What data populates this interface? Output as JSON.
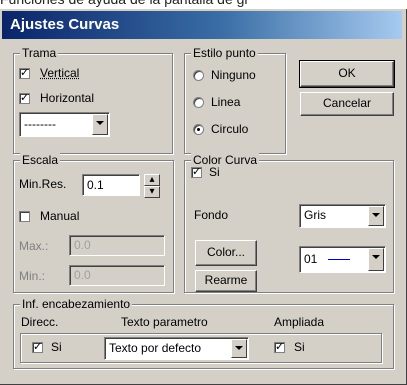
{
  "top_cut_text": "Funciones de ayuda de la pantalla de gr",
  "window": {
    "title": "Ajustes Curvas"
  },
  "trama": {
    "legend": "Trama",
    "vertical": {
      "label": "Vertical",
      "checked": true
    },
    "horizontal": {
      "label": "Horizontal",
      "checked": true
    },
    "line_style_value": "--------"
  },
  "estilo_punto": {
    "legend": "Estilo punto",
    "options": [
      {
        "label": "Ninguno",
        "selected": false
      },
      {
        "label": "Linea",
        "selected": false
      },
      {
        "label": "Circulo",
        "selected": true
      }
    ]
  },
  "buttons": {
    "ok": "OK",
    "cancel": "Cancelar",
    "color": "Color...",
    "rearme": "Rearme"
  },
  "escala": {
    "legend": "Escala",
    "min_res_label": "Min.Res.",
    "min_res_value": "0.1",
    "manual_label": "Manual",
    "manual_checked": false,
    "max_label": "Max.:",
    "max_value": "0.0",
    "min_label": "Min.:",
    "min_value": "0.0"
  },
  "color_curva": {
    "legend": "Color Curva",
    "si_label": "Si",
    "si_checked": true,
    "fondo_label": "Fondo",
    "fondo_value": "Gris",
    "curve_value": "01",
    "curve_color": "#0000cc"
  },
  "encabezamiento": {
    "legend": "Inf. encabezamiento",
    "direcc_label": "Direcc.",
    "texto_label": "Texto parametro",
    "ampliada_label": "Ampliada",
    "direcc_si": "Si",
    "texto_value": "Texto por defecto",
    "ampliada_si": "Si",
    "check_mark": "✓"
  }
}
